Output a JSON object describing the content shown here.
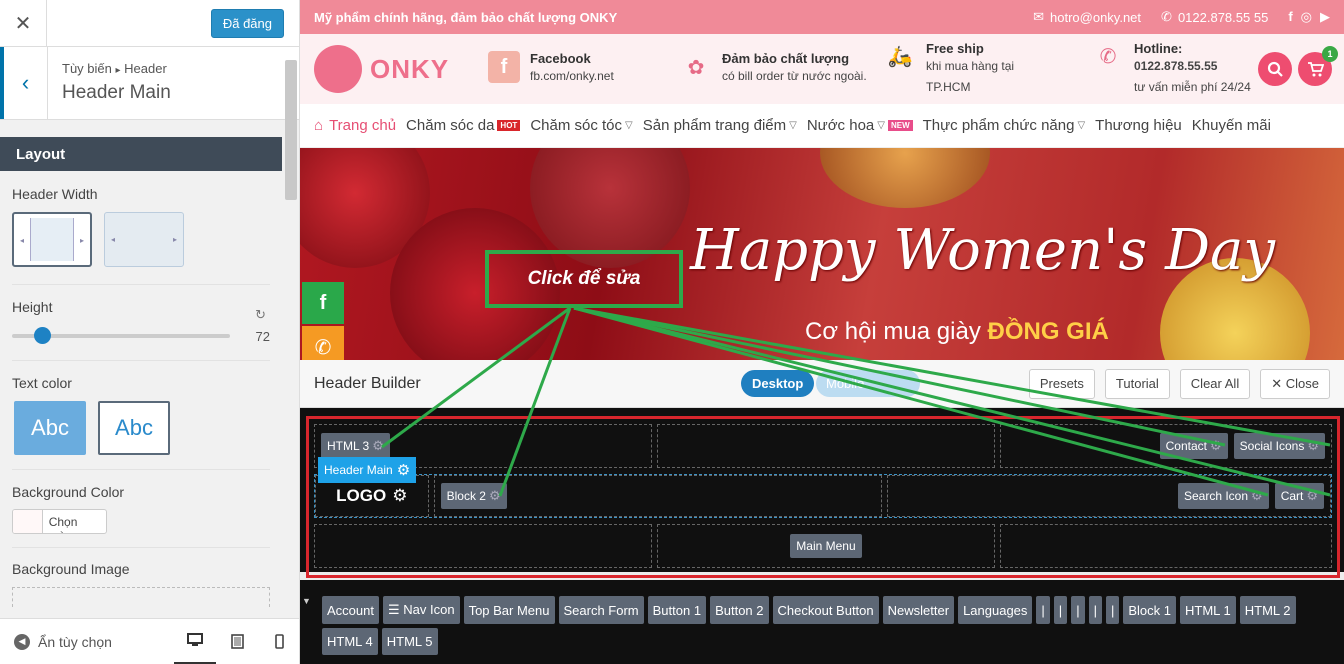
{
  "panel": {
    "close_icon": "close-icon",
    "publish_label": "Đã đăng",
    "breadcrumb_a": "Tùy biến",
    "breadcrumb_sep": "▸",
    "breadcrumb_b": "Header",
    "title": "Header Main",
    "section": "Layout",
    "header_width_label": "Header Width",
    "height_label": "Height",
    "height_value": 72,
    "text_color_label": "Text color",
    "text_color_opts": [
      "Abc",
      "Abc"
    ],
    "bg_color_label": "Background Color",
    "color_btn": "Chọn màu",
    "bg_image_label": "Background Image",
    "hide_label": "Ẩn tùy chọn"
  },
  "site": {
    "topbar_msg": "Mỹ phẩm chính hãng, đảm bảo chất lượng ONKY",
    "email": "hotro@onky.net",
    "phone": "0122.878.55 55",
    "social": [
      "f",
      "◎",
      "▶"
    ],
    "logo_text": "ONKY",
    "infos": [
      {
        "title": "Facebook",
        "text": "fb.com/onky.net",
        "icon": "facebook-icon"
      },
      {
        "title": "Đảm bảo chất lượng",
        "text": "có bill order từ nước ngoài.",
        "icon": "ribbon-icon"
      },
      {
        "title": "Free ship",
        "text": "khi mua hàng tại TP.HCM",
        "icon": "scooter-icon"
      },
      {
        "title": "Hotline:",
        "text": "0122.878.55.55",
        "text2": "tư vấn miễn phí 24/24",
        "icon": "phone-icon"
      }
    ],
    "cart_count": "1",
    "nav": [
      {
        "label": "Trang chủ"
      },
      {
        "label": "Chăm sóc da",
        "tag": "HOT"
      },
      {
        "label": "Chăm sóc tóc",
        "caret": true
      },
      {
        "label": "Sản phẩm trang điểm",
        "caret": true
      },
      {
        "label": "Nước hoa",
        "caret": true,
        "tag": "NEW"
      },
      {
        "label": "Thực phẩm chức năng",
        "caret": true
      },
      {
        "label": "Thương hiệu"
      },
      {
        "label": "Khuyến mãi"
      }
    ],
    "banner_title": "Happy Women's Day",
    "banner_sub_a": "Cơ hội mua giày ",
    "banner_sub_b": "ĐỒNG GIÁ",
    "click_label": "Click để sửa"
  },
  "builder": {
    "title": "Header Builder",
    "desktop": "Desktop",
    "mobile": "Mobile",
    "presets": "Presets",
    "tutorial": "Tutorial",
    "clear_all": "Clear All",
    "close": "Close",
    "row1": {
      "left": "HTML 3",
      "right": [
        "Contact",
        "Social Icons"
      ]
    },
    "header_main_tag": "Header Main",
    "row2": {
      "logo": "LOGO",
      "block": "Block 2",
      "right": [
        "Search Icon",
        "Cart"
      ]
    },
    "row3": {
      "center": "Main Menu"
    },
    "palette": [
      "Account",
      "☰ Nav Icon",
      "Top Bar Menu",
      "Search Form",
      "Button 1",
      "Button 2",
      "Checkout Button",
      "Newsletter",
      "Languages",
      "|",
      "|",
      "|",
      "|",
      "|",
      "Block 1",
      "HTML 1",
      "HTML 2",
      "HTML 4",
      "HTML 5"
    ]
  },
  "colors": {
    "accent": "#1f7fc0",
    "brand_pink": "#ee4d70",
    "highlight_green": "#2ea94a",
    "frame_red": "#d8262d"
  }
}
